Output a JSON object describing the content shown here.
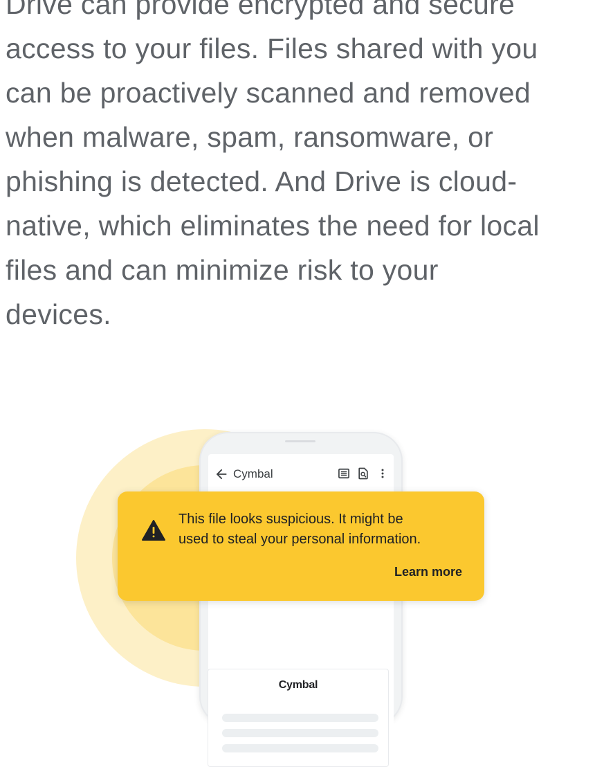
{
  "body_text": {
    "lines": [
      "Drive can provide encrypted and secure",
      "access to your files. Files shared with you",
      "can be proactively scanned and removed",
      "when malware, spam, ransomware, or",
      "phishing is detected. And Drive is cloud-",
      "native, which eliminates the need for local",
      "files and can minimize risk to your",
      "devices."
    ]
  },
  "illustration": {
    "app_bar": {
      "title": "Cymbal",
      "icons": [
        "back-arrow-icon",
        "comment-icon",
        "find-in-page-icon",
        "more-vert-icon"
      ]
    },
    "warning_banner": {
      "icon": "warning-triangle-icon",
      "message_lines": [
        "This file looks suspicious. It might be",
        "used to steal your personal information."
      ],
      "action_label": "Learn more"
    },
    "document": {
      "title": "Cymbal"
    }
  },
  "colors": {
    "body_text": "#5f6368",
    "warning_background": "#fbc82f",
    "glow_outer": "#fdf0c7",
    "glow_inner": "#fce49a"
  }
}
